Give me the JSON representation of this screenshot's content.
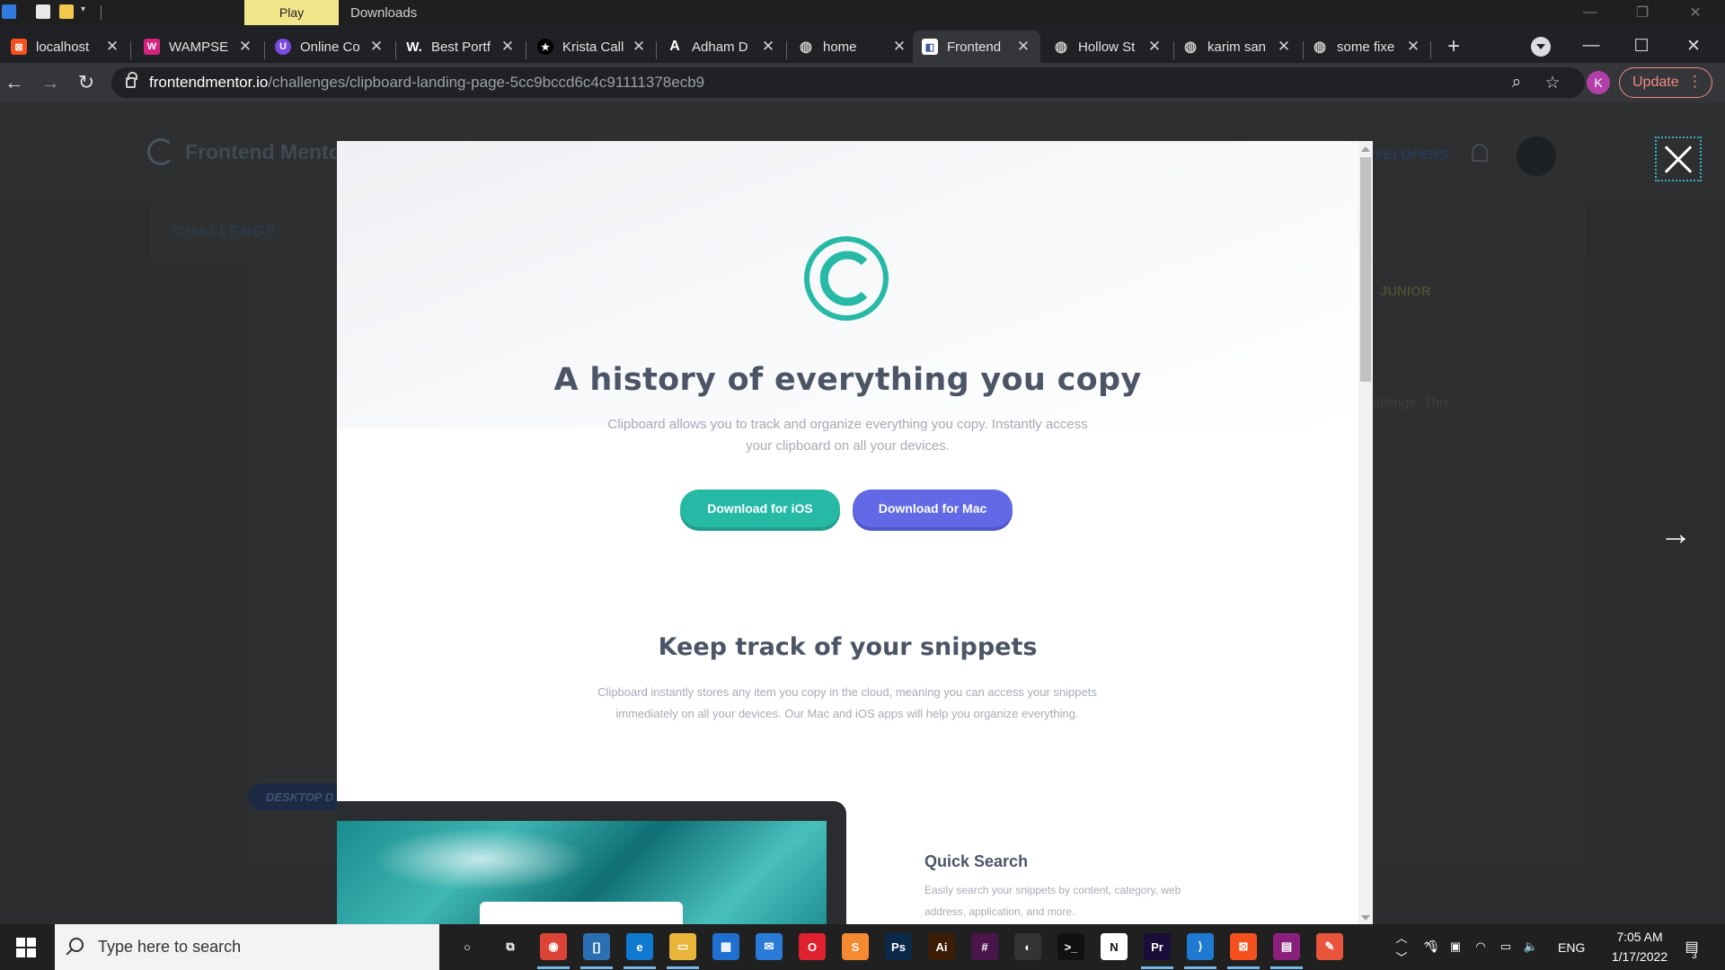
{
  "explorer_bar": {
    "play_label": "Play",
    "downloads_label": "Downloads",
    "controls": {
      "minimize": "—",
      "restore": "❐",
      "close": "✕"
    }
  },
  "tabs": [
    {
      "title": "localhost",
      "favicon": "xampp-icon",
      "color": "#f4511e",
      "glyph": "⊠"
    },
    {
      "title": "WAMPSE",
      "favicon": "wampserver-icon",
      "color": "#d6247e",
      "glyph": "W"
    },
    {
      "title": "Online Co",
      "favicon": "online-compiler-icon",
      "color": "#7b4ae2",
      "glyph": "U"
    },
    {
      "title": "Best Portf",
      "favicon": "w-icon",
      "color": "#202124",
      "glyph": "W."
    },
    {
      "title": "Krista Call",
      "favicon": "star-icon",
      "color": "#000000",
      "glyph": "★"
    },
    {
      "title": "Adham D",
      "favicon": "signature-icon",
      "color": "#202124",
      "glyph": "A"
    },
    {
      "title": "home",
      "favicon": "globe-icon",
      "color": "#202124",
      "glyph": "◍"
    },
    {
      "title": "Frontend",
      "favicon": "frontend-mentor-icon",
      "color": "#ffffff",
      "glyph": "◧",
      "active": true
    },
    {
      "title": "Hollow St",
      "favicon": "globe-icon",
      "color": "#202124",
      "glyph": "◍"
    },
    {
      "title": "karim san",
      "favicon": "globe-icon",
      "color": "#202124",
      "glyph": "◍"
    },
    {
      "title": "some fixe",
      "favicon": "globe-icon",
      "color": "#202124",
      "glyph": "◍"
    }
  ],
  "tab_close_glyph": "✕",
  "new_tab_glyph": "+",
  "chrome_controls": {
    "minimize": "—",
    "maximize": "☐",
    "close": "✕"
  },
  "nav": {
    "back": "←",
    "forward": "→",
    "reload": "↻"
  },
  "address": {
    "host": "frontendmentor.io",
    "path": "/challenges/clipboard-landing-page-5cc9bccd6c4c91111378ecb9"
  },
  "omnibox_icons": {
    "zoom": "⌕",
    "bookmark": "☆"
  },
  "profile_initial": "K",
  "update_label": "Update",
  "update_menu": "⋮",
  "background_page": {
    "brand": "Frontend Mentor",
    "developers": "VELOPERS",
    "challenge_tab": "CHALLENGE",
    "difficulty": "JUNIOR",
    "desc_fragment": "allenge. This",
    "desktop_badge": "DESKTOP D"
  },
  "overlay": {
    "next_glyph": "→"
  },
  "modal": {
    "hero_title": "A history of everything you copy",
    "hero_sub": "Clipboard allows you to track and organize everything you copy. Instantly access your clipboard on all your devices.",
    "btn_ios": "Download for iOS",
    "btn_mac": "Download for Mac",
    "section_title": "Keep track of your snippets",
    "section_sub": "Clipboard instantly stores any item you copy in the cloud, meaning you can access your snippets immediately on all your devices. Our Mac and iOS apps will help you organize everything.",
    "feature_title": "Quick Search",
    "feature_text": "Easily search your snippets by content, category, web address, application, and more.",
    "accent_teal": "#26b9a5",
    "accent_blue": "#6169e6"
  },
  "taskbar": {
    "search_placeholder": "Type here to search",
    "apps": [
      {
        "name": "cortana-icon",
        "glyph": "○",
        "color": "#202020"
      },
      {
        "name": "task-view-icon",
        "glyph": "⧉",
        "color": "#202020"
      },
      {
        "name": "chrome-icon",
        "glyph": "◉",
        "color": "#db4437"
      },
      {
        "name": "jetbrains-icon",
        "glyph": "[]",
        "color": "#2b6fb3"
      },
      {
        "name": "edge-icon",
        "glyph": "e",
        "color": "#0f7ad0"
      },
      {
        "name": "file-explorer-icon",
        "glyph": "▭",
        "color": "#e9b43a"
      },
      {
        "name": "store-icon",
        "glyph": "▦",
        "color": "#1f6fd1"
      },
      {
        "name": "mail-icon",
        "glyph": "✉",
        "color": "#2a7ad8"
      },
      {
        "name": "opera-icon",
        "glyph": "O",
        "color": "#e0212f"
      },
      {
        "name": "sublime-icon",
        "glyph": "S",
        "color": "#f58a32"
      },
      {
        "name": "photoshop-icon",
        "glyph": "Ps",
        "color": "#0b2a4a"
      },
      {
        "name": "illustrator-icon",
        "glyph": "Ai",
        "color": "#3b1c05"
      },
      {
        "name": "slack-icon",
        "glyph": "#",
        "color": "#4a154b"
      },
      {
        "name": "github-icon",
        "glyph": "◐",
        "color": "#333333"
      },
      {
        "name": "terminal-icon",
        "glyph": ">_",
        "color": "#111111"
      },
      {
        "name": "notion-icon",
        "glyph": "N",
        "color": "#ffffff"
      },
      {
        "name": "premiere-icon",
        "glyph": "Pr",
        "color": "#1a0d3a"
      },
      {
        "name": "vscode-icon",
        "glyph": "⟩",
        "color": "#1f7ad1"
      },
      {
        "name": "xampp-icon",
        "glyph": "⊠",
        "color": "#f4511e"
      },
      {
        "name": "winrar-icon",
        "glyph": "▤",
        "color": "#8a1f7c"
      },
      {
        "name": "paint-icon",
        "glyph": "✎",
        "color": "#e8553c"
      }
    ],
    "language": "ENG",
    "time": "7:05 AM",
    "date": "1/17/2022",
    "notifications": "3"
  }
}
